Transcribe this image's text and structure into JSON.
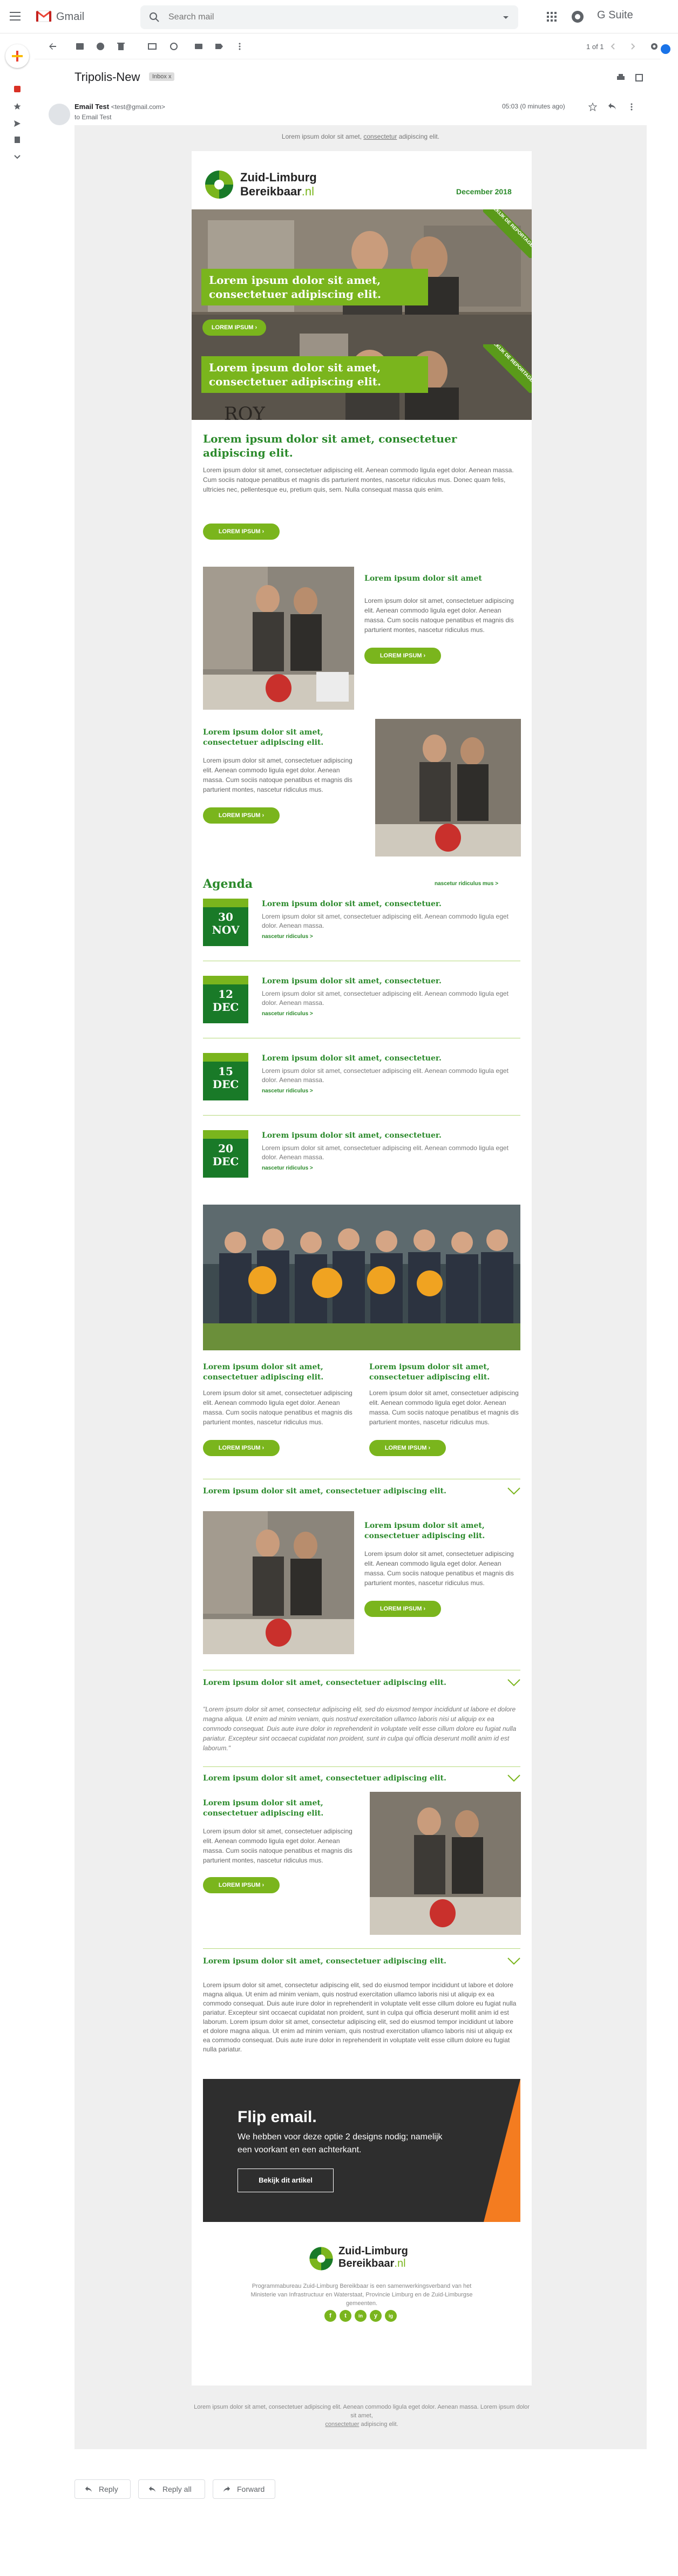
{
  "app": {
    "name": "Gmail",
    "suite": "G Suite"
  },
  "search": {
    "placeholder": "Search mail"
  },
  "toolbar": {
    "pager": "1 of 1"
  },
  "message": {
    "subject": "Tripolis-New",
    "label_chip": "Inbox x",
    "sender_name": "Email Test",
    "sender_email": "<test@gmail.com>",
    "to": "to Email Test",
    "time": "05:03 (0 minutes ago)"
  },
  "email": {
    "preheader": "Lorem ipsum dolor sit amet, ",
    "preheader_link": "consectetur",
    "preheader_tail": " adipiscing elit.",
    "logo_line1": "Zuid-Limburg",
    "logo_line2": "Bereikbaar",
    "logo_tld": ".nl",
    "date": "December 2018",
    "hero": {
      "band1": "Lorem ipsum dolor sit amet, consectetuer adipiscing elit.",
      "btn1": "LOREM IPSUM",
      "band2": "Lorem ipsum dolor sit amet, consectetuer adipiscing elit.",
      "ribbon": "BEKIJK DE REPORTAGE"
    },
    "intro": {
      "title": "Lorem ipsum dolor sit amet, consectetuer adipiscing elit.",
      "text": "Lorem ipsum dolor sit amet, consectetuer adipiscing elit. Aenean commodo ligula eget dolor. Aenean massa. Cum sociis natoque penatibus et magnis dis parturient montes, nascetur ridiculus mus. Donec quam felis, ultricies nec, pellentesque eu, pretium quis, sem. Nulla consequat massa quis enim.",
      "btn": "LOREM IPSUM"
    },
    "feature1": {
      "title": "Lorem ipsum dolor sit amet",
      "text": "Lorem ipsum dolor sit amet, consectetuer adipiscing elit. Aenean commodo ligula eget dolor. Aenean massa. Cum sociis natoque penatibus et magnis dis parturient montes, nascetur ridiculus mus.",
      "btn": "LOREM IPSUM"
    },
    "feature2": {
      "title": "Lorem ipsum dolor sit amet, consectetuer adipiscing elit.",
      "text": "Lorem ipsum dolor sit amet, consectetuer adipiscing elit. Aenean commodo ligula eget dolor. Aenean massa. Cum sociis natoque penatibus et magnis dis parturient montes, nascetur ridiculus mus.",
      "btn": "LOREM IPSUM"
    },
    "agenda": {
      "title": "Agenda",
      "more": "nascetur ridiculus mus >",
      "items": [
        {
          "day": "30",
          "month": "NOV",
          "title": "Lorem ipsum dolor sit amet, consectetuer.",
          "text": "Lorem ipsum dolor sit amet, consectetuer adipiscing elit. Aenean commodo ligula eget dolor. Aenean massa.",
          "link": "nascetur ridiculus >"
        },
        {
          "day": "12",
          "month": "DEC",
          "title": "Lorem ipsum dolor sit amet, consectetuer.",
          "text": "Lorem ipsum dolor sit amet, consectetuer adipiscing elit. Aenean commodo ligula eget dolor. Aenean massa.",
          "link": "nascetur ridiculus >"
        },
        {
          "day": "15",
          "month": "DEC",
          "title": "Lorem ipsum dolor sit amet, consectetuer.",
          "text": "Lorem ipsum dolor sit amet, consectetuer adipiscing elit. Aenean commodo ligula eget dolor. Aenean massa.",
          "link": "nascetur ridiculus >"
        },
        {
          "day": "20",
          "month": "DEC",
          "title": "Lorem ipsum dolor sit amet, consectetuer.",
          "text": "Lorem ipsum dolor sit amet, consectetuer adipiscing elit. Aenean commodo ligula eget dolor. Aenean massa.",
          "link": "nascetur ridiculus >"
        }
      ]
    },
    "twocol": [
      {
        "title": "Lorem ipsum dolor sit amet, consectetuer adipiscing elit.",
        "text": "Lorem ipsum dolor sit amet, consectetuer adipiscing elit. Aenean commodo ligula eget dolor. Aenean massa. Cum sociis natoque penatibus et magnis dis parturient montes, nascetur ridiculus mus.",
        "btn": "LOREM IPSUM"
      },
      {
        "title": "Lorem ipsum dolor sit amet, consectetuer adipiscing elit.",
        "text": "Lorem ipsum dolor sit amet, consectetuer adipiscing elit. Aenean commodo ligula eget dolor. Aenean massa. Cum sociis natoque penatibus et magnis dis parturient montes, nascetur ridiculus mus.",
        "btn": "LOREM IPSUM"
      }
    ],
    "accordions": [
      "Lorem ipsum dolor sit amet, consectetuer adipiscing elit.",
      "Lorem ipsum dolor sit amet, consectetuer adipiscing elit.",
      "Lorem ipsum dolor sit amet, consectetuer adipiscing elit.",
      "Lorem ipsum dolor sit amet, consectetuer adipiscing elit."
    ],
    "acc1": {
      "title": "Lorem ipsum dolor sit amet, consectetuer adipiscing elit.",
      "text": "Lorem ipsum dolor sit amet, consectetuer adipiscing elit. Aenean commodo ligula eget dolor. Aenean massa. Cum sociis natoque penatibus et magnis dis parturient montes, nascetur ridiculus mus.",
      "btn": "LOREM IPSUM"
    },
    "quote": "\"Lorem ipsum dolor sit amet, consectetur adipiscing elit, sed do eiusmod tempor incididunt ut labore et dolore magna aliqua. Ut enim ad minim veniam, quis nostrud exercitation ullamco laboris nisi ut aliquip ex ea commodo consequat. Duis aute irure dolor in reprehenderit in voluptate velit esse cillum dolore eu fugiat nulla pariatur. Excepteur sint occaecat cupidatat non proident, sunt in culpa qui officia deserunt mollit anim id est laborum.\"",
    "acc3": {
      "title": "Lorem ipsum dolor sit amet, consectetuer adipiscing elit.",
      "text": "Lorem ipsum dolor sit amet, consectetuer adipiscing elit. Aenean commodo ligula eget dolor. Aenean massa. Cum sociis natoque penatibus et magnis dis parturient montes, nascetur ridiculus mus.",
      "btn": "LOREM IPSUM"
    },
    "longtext": "Lorem ipsum dolor sit amet, consectetur adipiscing elit, sed do eiusmod tempor incididunt ut labore et dolore magna aliqua. Ut enim ad minim veniam, quis nostrud exercitation ullamco laboris nisi ut aliquip ex ea commodo consequat. Duis aute irure dolor in reprehenderit in voluptate velit esse cillum dolore eu fugiat nulla pariatur. Excepteur sint occaecat cupidatat non proident, sunt in culpa qui officia deserunt mollit anim id est laborum. Lorem ipsum dolor sit amet, consectetur adipiscing elit, sed do eiusmod tempor incididunt ut labore et dolore magna aliqua. Ut enim ad minim veniam, quis nostrud exercitation ullamco laboris nisi ut aliquip ex ea commodo consequat. Duis aute irure dolor in reprehenderit in voluptate velit esse cillum dolore eu fugiat nulla pariatur.",
    "flip": {
      "title": "Flip email.",
      "text": "We hebben voor deze optie 2 designs nodig; namelijk een voorkant en een achterkant.",
      "btn": "Bekijk dit artikel"
    },
    "footer": {
      "text": "Programmabureau Zuid-Limburg Bereikbaar is een samenwerkingsverband van het Ministerie van Infrastructuur en Waterstaat, Provincie Limburg en de Zuid-Limburgse gemeenten.",
      "social": [
        "f",
        "t",
        "in",
        "y",
        "ig"
      ]
    },
    "bottom_text": "Lorem ipsum dolor sit amet, consectetuer adipiscing elit. Aenean commodo ligula eget dolor. Aenean massa. Lorem ipsum dolor sit amet,",
    "bottom_link": "consectetuer",
    "bottom_tail": " adipiscing elit."
  },
  "reply_actions": {
    "reply": "Reply",
    "reply_all": "Reply all",
    "forward": "Forward"
  },
  "colors": {
    "brand_green": "#7ab51d",
    "dark_green": "#197a28",
    "heading_green": "#2b8a2b",
    "gmail_red": "#ea4335",
    "flip_accent": "#f47c20"
  }
}
